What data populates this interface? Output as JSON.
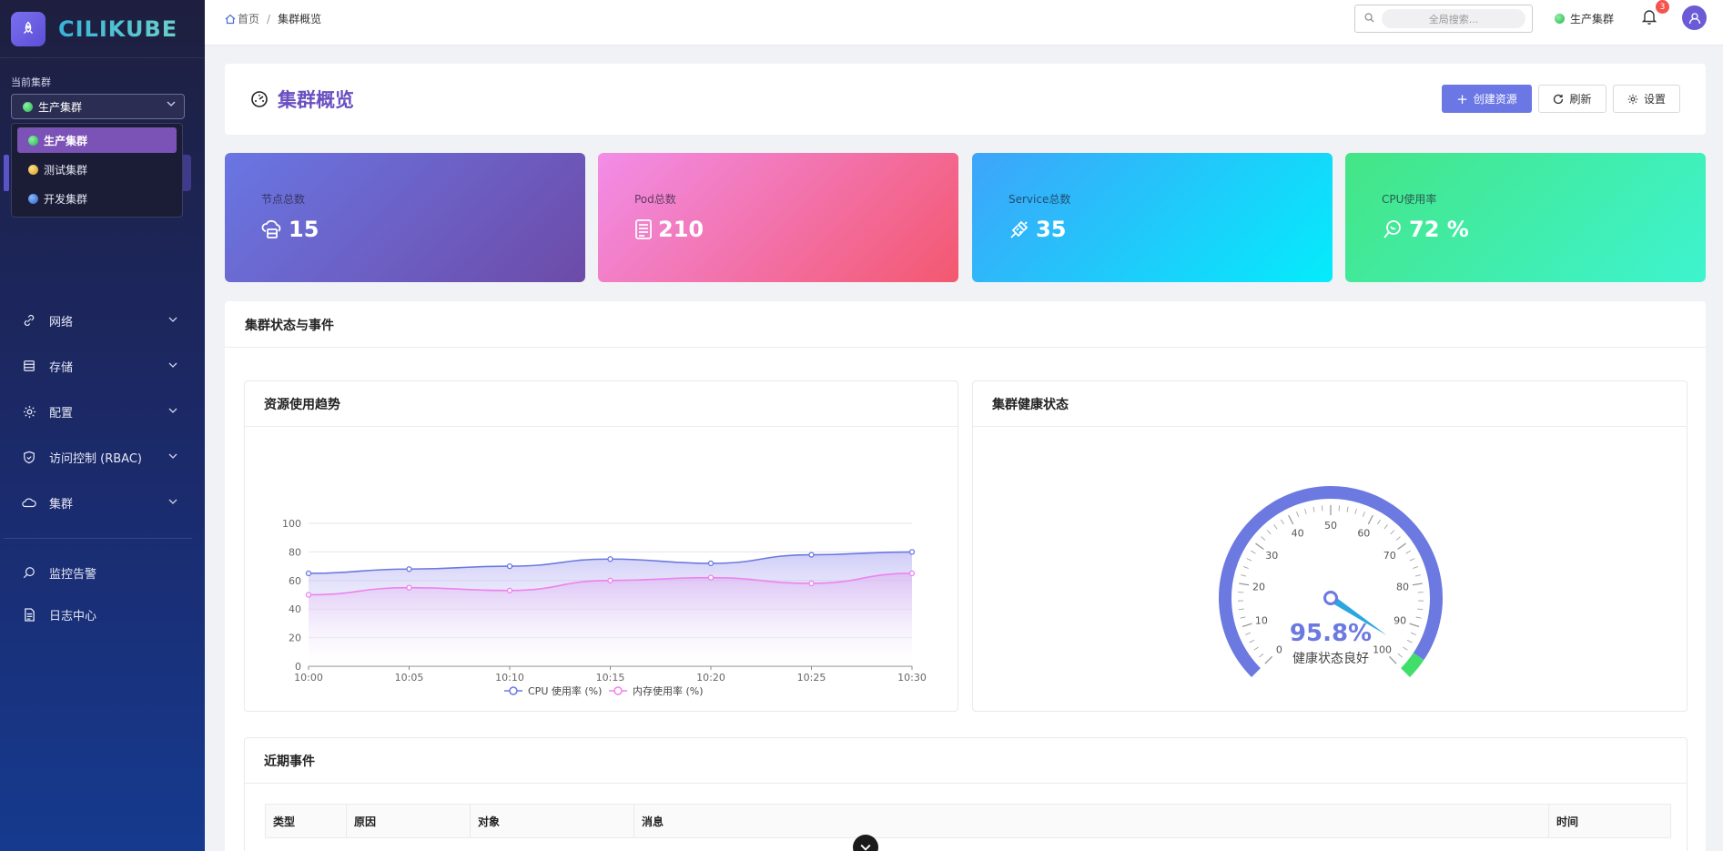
{
  "app": {
    "name": "CILIKUBE"
  },
  "sidebar": {
    "current_cluster_label": "当前集群",
    "selected_cluster": "生产集群",
    "cluster_options": [
      {
        "label": "生产集群",
        "color": "#2fbf5a",
        "active": true
      },
      {
        "label": "测试集群",
        "color": "#e0a52a",
        "active": false
      },
      {
        "label": "开发集群",
        "color": "#3a6fd0",
        "active": false
      }
    ],
    "items": [
      {
        "label": "网络",
        "icon": "link-icon",
        "has_children": true
      },
      {
        "label": "存储",
        "icon": "database-icon",
        "has_children": true
      },
      {
        "label": "配置",
        "icon": "gear-icon",
        "has_children": true
      },
      {
        "label": "访问控制 (RBAC)",
        "icon": "shield-icon",
        "has_children": true
      },
      {
        "label": "集群",
        "icon": "cloud-icon",
        "has_children": true
      },
      {
        "label": "监控告警",
        "icon": "magnify-icon",
        "has_children": false
      },
      {
        "label": "日志中心",
        "icon": "document-icon",
        "has_children": false
      }
    ]
  },
  "topbar": {
    "breadcrumb": [
      "首页",
      "集群概览"
    ],
    "search_placeholder": "全局搜索...",
    "cluster": "生产集群",
    "notification_count": "3"
  },
  "header": {
    "title": "集群概览",
    "create_label": "创建资源",
    "refresh_label": "刷新",
    "settings_label": "设置"
  },
  "stats": [
    {
      "label": "节点总数",
      "value": "15",
      "icon": "cloud-server-icon"
    },
    {
      "label": "Pod总数",
      "value": "210",
      "icon": "pod-icon"
    },
    {
      "label": "Service总数",
      "value": "35",
      "icon": "plug-icon"
    },
    {
      "label": "CPU使用率",
      "value": "72 %",
      "icon": "speech-icon"
    }
  ],
  "status_panel": {
    "title": "集群状态与事件"
  },
  "trend": {
    "title": "资源使用趋势",
    "chart_data": {
      "type": "area",
      "x": [
        "10:00",
        "10:05",
        "10:10",
        "10:15",
        "10:20",
        "10:25",
        "10:30"
      ],
      "ylim": [
        0,
        100
      ],
      "yticks": [
        0,
        20,
        40,
        60,
        80,
        100
      ],
      "series": [
        {
          "name": "CPU 使用率 (%)",
          "values": [
            65,
            68,
            70,
            75,
            72,
            78,
            80
          ],
          "color": "#6b79e0"
        },
        {
          "name": "内存使用率 (%)",
          "values": [
            50,
            55,
            53,
            60,
            62,
            58,
            65
          ],
          "color": "#ee82ee"
        }
      ],
      "legend": "bottom"
    }
  },
  "health": {
    "title": "集群健康状态",
    "value": 95.8,
    "value_text": "95.8%",
    "status_text": "健康状态良好",
    "ticks": [
      "0",
      "10",
      "20",
      "30",
      "40",
      "50",
      "60",
      "70",
      "80",
      "90",
      "100"
    ],
    "colors": {
      "primary": "#6b79e0",
      "good": "#3fdf6a",
      "pointer": "#2aa6e0"
    }
  },
  "events": {
    "title": "近期事件",
    "columns": [
      "类型",
      "原因",
      "对象",
      "消息",
      "时间"
    ]
  }
}
